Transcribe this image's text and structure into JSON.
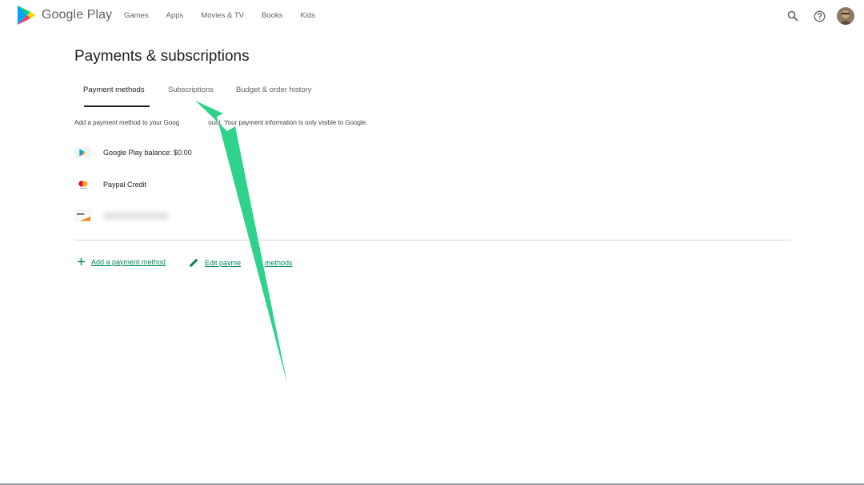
{
  "header": {
    "brand": "Google Play",
    "nav": [
      "Games",
      "Apps",
      "Movies & TV",
      "Books",
      "Kids"
    ],
    "icons": [
      "search-icon",
      "help-icon",
      "avatar"
    ]
  },
  "page": {
    "title": "Payments & subscriptions",
    "tabs": [
      {
        "label": "Payment methods",
        "active": true
      },
      {
        "label": "Subscriptions",
        "active": false
      },
      {
        "label": "Budget & order history",
        "active": false
      }
    ],
    "info_text_left": "Add a payment method to your Goog",
    "info_text_right": "ount. Your payment information is only visible to Google.",
    "payment_methods": [
      {
        "label": "Google Play balance: $0.00",
        "icon": "google-play-icon"
      },
      {
        "label": "Paypal Credit",
        "icon": "mastercard-icon"
      },
      {
        "label": "",
        "icon": "card-icon"
      }
    ],
    "actions": {
      "add_label": "Add a payment method",
      "edit_label_left": "Edit payme",
      "edit_label_right": "methods"
    }
  },
  "colors": {
    "accent": "#01875f",
    "annotation_arrow": "#2fd28a"
  }
}
